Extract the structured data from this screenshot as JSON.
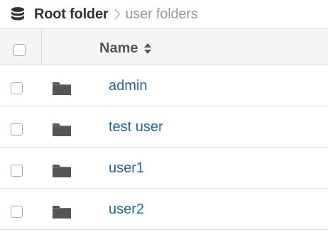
{
  "breadcrumb": {
    "root_label": "Root folder",
    "current_label": "user folders",
    "root_icon": "database-icon",
    "separator_icon": "chevron-right-icon"
  },
  "table": {
    "header": {
      "name_label": "Name",
      "sort_icon": "sort-icon"
    },
    "rows": [
      {
        "name": "admin",
        "icon": "folder-icon"
      },
      {
        "name": "test user",
        "icon": "folder-icon"
      },
      {
        "name": "user1",
        "icon": "folder-icon"
      },
      {
        "name": "user2",
        "icon": "folder-icon"
      }
    ]
  },
  "colors": {
    "link": "#23668f",
    "header_bg": "#f5f5f5",
    "border": "#dddddd",
    "muted_text": "#999999",
    "icon": "#555555"
  }
}
